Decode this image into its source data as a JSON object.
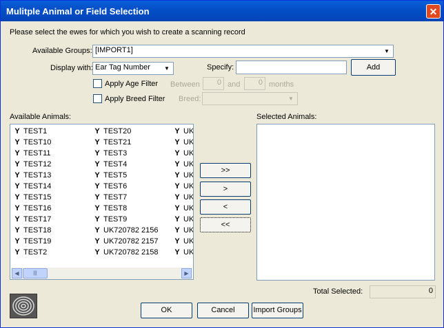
{
  "window": {
    "title": "Mulitple Animal or Field Selection",
    "close_symbol": "✕"
  },
  "instruction": "Please select the ewes for which you wish to create a scanning record",
  "groups": {
    "label": "Available Groups:",
    "value": "[IMPORT1]"
  },
  "display": {
    "label": "Display with:",
    "value": "Ear Tag Number"
  },
  "specify": {
    "label": "Specify:",
    "value": "",
    "add_label": "Add"
  },
  "age_filter": {
    "label": "Apply Age Filter",
    "between_label": "Between",
    "min": "0",
    "and_label": "and",
    "max": "0",
    "unit": "months"
  },
  "breed_filter": {
    "label": "Apply Breed Filter",
    "breed_label": "Breed:",
    "value": ""
  },
  "available": {
    "label": "Available Animals:",
    "col1": [
      "TEST1",
      "TEST10",
      "TEST11",
      "TEST12",
      "TEST13",
      "TEST14",
      "TEST15",
      "TEST16",
      "TEST17",
      "TEST18",
      "TEST19",
      "TEST2"
    ],
    "col2": [
      "TEST20",
      "TEST21",
      "TEST3",
      "TEST4",
      "TEST5",
      "TEST6",
      "TEST7",
      "TEST8",
      "TEST9",
      "UK720782 2156",
      "UK720782 2157",
      "UK720782 2158"
    ],
    "col3": [
      "UK",
      "UK",
      "UK",
      "UK",
      "UK",
      "UK",
      "UK",
      "UK",
      "UK",
      "UK",
      "UK",
      "UK"
    ]
  },
  "transfer": {
    "add_all": ">>",
    "add": ">",
    "remove": "<",
    "remove_all": "<<"
  },
  "selected": {
    "label": "Selected Animals:",
    "items": []
  },
  "total": {
    "label": "Total Selected:",
    "value": "0"
  },
  "buttons": {
    "ok": "OK",
    "cancel": "Cancel",
    "import": "Import Groups"
  },
  "icons": {
    "animal": "sheep-head-icon",
    "dropdown": "▼",
    "scroll_left": "◀",
    "scroll_right": "▶",
    "thumb_grip": "|||"
  }
}
